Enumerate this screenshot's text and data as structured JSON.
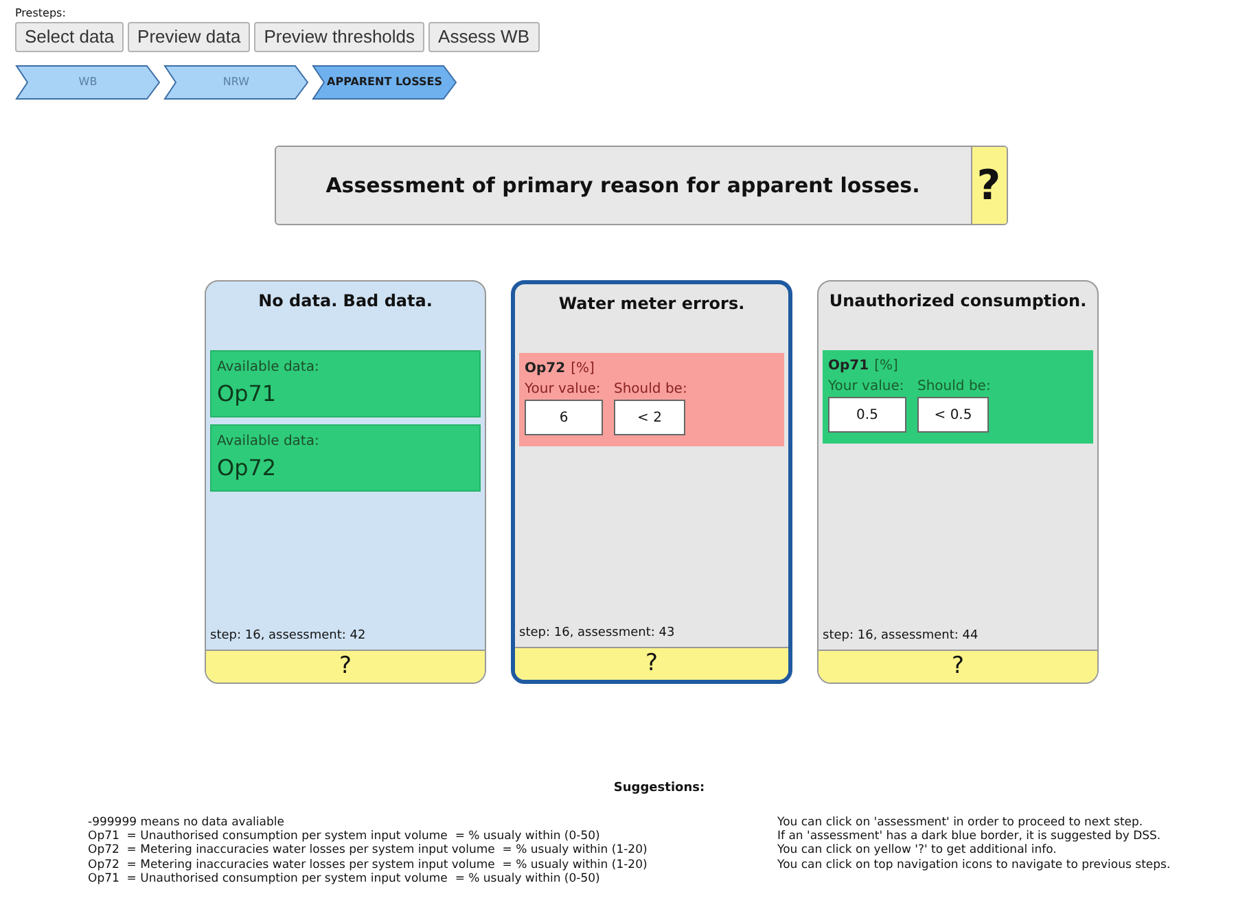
{
  "presteps_label": "Presteps:",
  "presteps": [
    "Select data",
    "Preview data",
    "Preview thresholds",
    "Assess WB"
  ],
  "breadcrumb": [
    {
      "label": "WB",
      "selected": false
    },
    {
      "label": "NRW",
      "selected": false
    },
    {
      "label": "APPARENT LOSSES",
      "selected": true
    }
  ],
  "title": "Assessment of primary reason for apparent losses.",
  "title_help": "?",
  "assessments": [
    {
      "title": "No data. Bad data.",
      "suggested": false,
      "color": "#cfe2f3",
      "items": [
        {
          "kind": "available",
          "label": "Available data:",
          "value": "Op71"
        },
        {
          "kind": "available",
          "label": "Available data:",
          "value": "Op72"
        }
      ],
      "footer": "step: 16, assessment: 42",
      "help": "?"
    },
    {
      "title": "Water meter errors.",
      "suggested": true,
      "color": "#e6e6e6",
      "items": [
        {
          "kind": "indicator",
          "color": "#f9a09c",
          "name": "Op72",
          "unit": "[%]",
          "your_label": "Your value:",
          "your_value": "6",
          "should_label": "Should be:",
          "should_value": "< 2"
        }
      ],
      "footer": "step: 16, assessment: 43",
      "help": "?"
    },
    {
      "title": "Unauthorized consumption.",
      "suggested": false,
      "color": "#e6e6e6",
      "items": [
        {
          "kind": "indicator",
          "color": "#2ecc7a",
          "name": "Op71",
          "unit": "[%]",
          "your_label": "Your value:",
          "your_value": "0.5",
          "should_label": "Should be:",
          "should_value": "< 0.5"
        }
      ],
      "footer": "step: 16, assessment: 44",
      "help": "?"
    }
  ],
  "suggestions_title": "Suggestions:",
  "notes_left": [
    "-999999 means no data avaliable",
    "Op71  = Unauthorised consumption per system input volume  = % usualy within (0-50)",
    "Op72  = Metering inaccuracies water losses per system input volume  = % usualy within (1-20)",
    "Op72  = Metering inaccuracies water losses per system input volume  = % usualy within (1-20)",
    "Op71  = Unauthorised consumption per system input volume  = % usualy within (0-50)"
  ],
  "notes_right": [
    "You can click on 'assessment' in order to proceed to next step.",
    "If an 'assessment' has a dark blue border, it is suggested by DSS.",
    "You can click on yellow '?' to get additional info.",
    "You can click on top navigation icons to navigate to previous steps."
  ]
}
